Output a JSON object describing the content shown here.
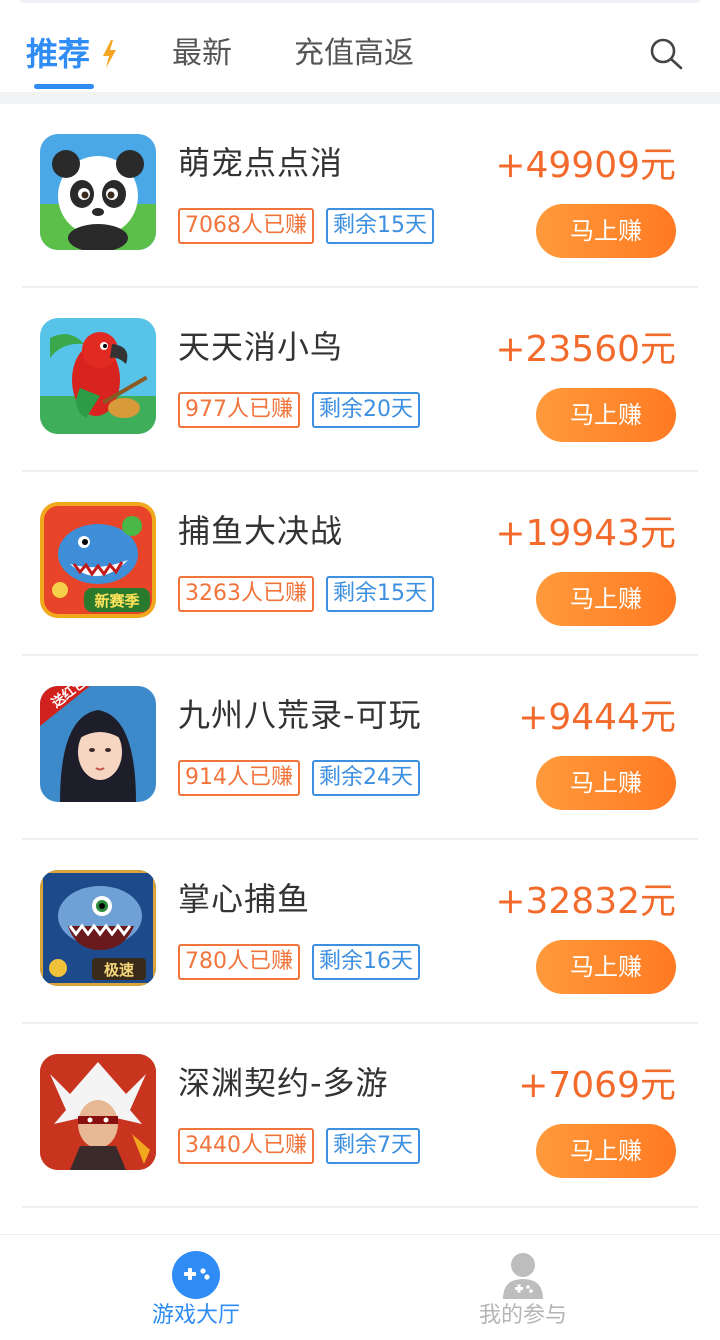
{
  "tabs": [
    {
      "label": "推荐",
      "active": true
    },
    {
      "label": "最新",
      "active": false
    },
    {
      "label": "充值高返",
      "active": false
    }
  ],
  "colors": {
    "accent": "#2f8cf4",
    "reward": "#f26a2c",
    "button": "#ff8a2c",
    "tag_earned": "#f0743b",
    "tag_left": "#3d8fe0"
  },
  "games": [
    {
      "title": "萌宠点点消",
      "earned": "7068人已赚",
      "remaining": "剩余15天",
      "reward": "+49909元",
      "button": "马上赚",
      "icon": "panda-icon"
    },
    {
      "title": "天天消小鸟",
      "earned": "977人已赚",
      "remaining": "剩余20天",
      "reward": "+23560元",
      "button": "马上赚",
      "icon": "parrot-icon"
    },
    {
      "title": "捕鱼大决战",
      "earned": "3263人已赚",
      "remaining": "剩余15天",
      "reward": "+19943元",
      "button": "马上赚",
      "icon": "shark-icon",
      "icon_badge": "新赛季"
    },
    {
      "title": "九州八荒录-可玩",
      "earned": "914人已赚",
      "remaining": "剩余24天",
      "reward": "+9444元",
      "button": "马上赚",
      "icon": "heroine-icon",
      "icon_badge": "送红包"
    },
    {
      "title": "掌心捕鱼",
      "earned": "780人已赚",
      "remaining": "剩余16天",
      "reward": "+32832元",
      "button": "马上赚",
      "icon": "shark-fish-icon",
      "icon_badge": "极速"
    },
    {
      "title": "深渊契约-多游",
      "earned": "3440人已赚",
      "remaining": "剩余7天",
      "reward": "+7069元",
      "button": "马上赚",
      "icon": "warrior-icon"
    }
  ],
  "bottom_nav": [
    {
      "label": "游戏大厅",
      "active": true,
      "icon": "gamepad-icon"
    },
    {
      "label": "我的参与",
      "active": false,
      "icon": "user-game-icon"
    }
  ]
}
